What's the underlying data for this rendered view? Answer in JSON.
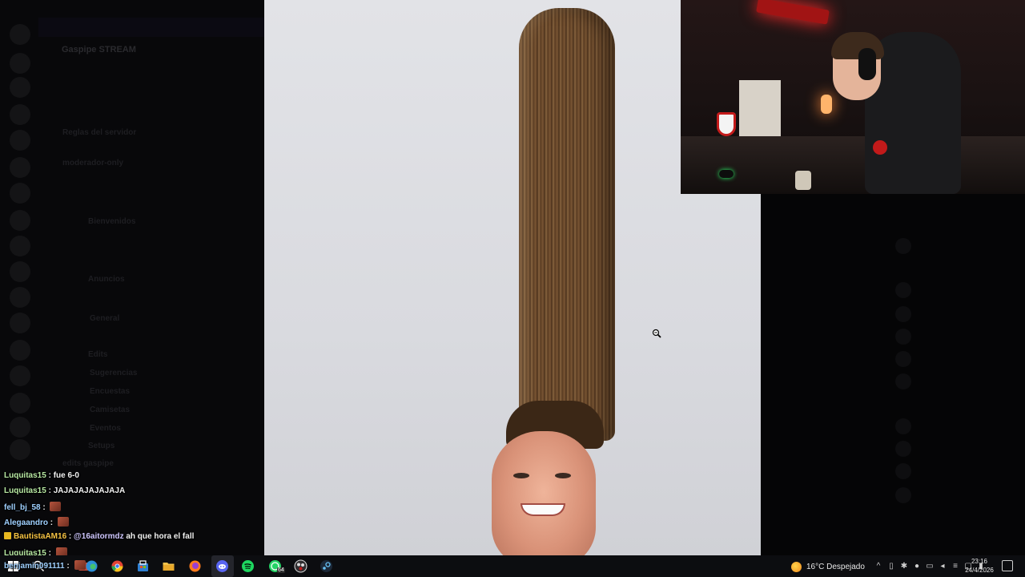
{
  "discord": {
    "server_name": "Gaspipe STREAM",
    "channels": [
      "Reglas del servidor",
      "moderador-only",
      "Bienvenidos",
      "Anuncios",
      "General",
      "Edits",
      "Sugerencias",
      "Encuestas",
      "Camisetas",
      "Eventos",
      "Setups",
      "edits gaspipe"
    ]
  },
  "chat": {
    "messages": [
      {
        "user": "Luquitas15",
        "text": "fue 6-0",
        "user_color": "green"
      },
      {
        "user": "Luquitas15",
        "text": "JAJAJAJAJAJAJA",
        "user_color": "green"
      },
      {
        "user": "fell_bj_58",
        "text": "",
        "user_color": "blue",
        "emote": true
      },
      {
        "user": "Alegaandro",
        "text": "",
        "user_color": "blue",
        "emote": true
      },
      {
        "user": "BautistaAM16",
        "mention": "@16aitormdz",
        "text": "ah que hora el fall",
        "user_color": "yellow",
        "badge": true
      },
      {
        "user": "Luquitas15",
        "text": "",
        "user_color": "green",
        "emote": true
      },
      {
        "user": "benjamin091111",
        "text": "",
        "user_color": "blue",
        "emote": true
      }
    ]
  },
  "taskbar": {
    "icons": [
      "windows-start-icon",
      "search-icon",
      "edge-icon",
      "chrome-icon",
      "store-icon",
      "file-explorer-icon",
      "firefox-icon",
      "discord-icon",
      "spotify-icon",
      "whatsapp-icon",
      "obs-icon",
      "steam-icon"
    ],
    "whatsapp_badge": "64",
    "weather": "16°C  Despejado",
    "time": "23:16",
    "date": "24/4/2026"
  },
  "colors": {
    "taskbar_bg": "#0c0d10",
    "chat_green": "#b7e8a2",
    "chat_yellow": "#f6c343",
    "image_bg": "#dcdde2"
  }
}
